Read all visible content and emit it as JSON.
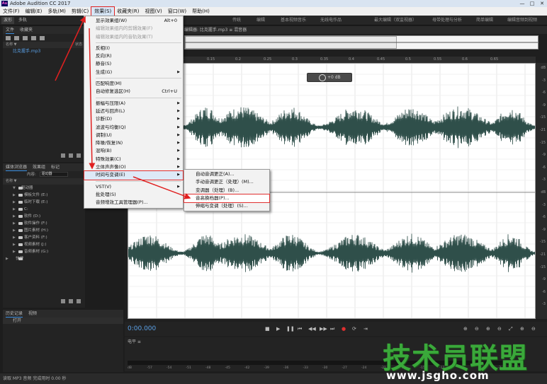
{
  "titlebar": {
    "title": "Adobe Audition CC 2017",
    "logo": "Au",
    "min": "—",
    "max": "□",
    "close": "✕"
  },
  "menubar": {
    "items": [
      "文件(F)",
      "编辑(E)",
      "多轨(M)",
      "剪辑(C)",
      "效果(S)",
      "收藏夹(R)",
      "视图(V)",
      "窗口(W)",
      "帮助(H)"
    ]
  },
  "toolbar": {
    "waveform": "波形",
    "multitrack": "多轨",
    "workspaces": [
      "传统",
      "编辑",
      "基本视频音乐",
      "无线电作品",
      "最大编辑（双监视器）",
      "母带处理与分析",
      "简单编辑",
      "编辑音频到视频"
    ]
  },
  "files_panel": {
    "tab_files": "文件",
    "tab_favorites": "收藏夹",
    "col_name": "名称 ▼",
    "col_status": "状态",
    "file": "比克握手.mp3"
  },
  "media_browser": {
    "tab_media": "媒体浏览器",
    "tab_effects": "效果组",
    "tab_markers": "标记",
    "content_label": "内容:",
    "content_value": "驱动器",
    "col_name": "名称 ▼",
    "drives_root": "驱动器",
    "drives": [
      "模板文件 (E:)",
      "临时下载 (E:)",
      "C:",
      "软件 (D:)",
      "软件操作 (F:)",
      "图片素材 (H:)",
      "客户资料 (F:)",
      "视频素材 (J:)",
      "音频素材 (G:)"
    ],
    "shortcut": "快捷"
  },
  "history_panel": {
    "tab_history": "历史记录",
    "tab_video": "视频",
    "item": "打开"
  },
  "editor": {
    "header": "编辑器: 比克握手.mp3 ≡   混音器",
    "timecode": "0:00.000",
    "hud_value": "+0 dB",
    "ruler_ticks": [
      "0.05",
      "0.1",
      "0.15",
      "0.2",
      "0.25",
      "0.3",
      "0.35",
      "0.4",
      "0.45",
      "0.5",
      "0.55",
      "0.6",
      "0.65"
    ],
    "db_labels": [
      "dB",
      "-3",
      "-6",
      "-9",
      "-15",
      "-21",
      "-15",
      "-9",
      "-6",
      "-3",
      "dB",
      "-3",
      "-6",
      "-9",
      "-15",
      "-21",
      "-15",
      "-9",
      "-6",
      "-3"
    ]
  },
  "levels": {
    "header": "电平 ≡",
    "ticks": [
      "dB",
      "-57",
      "-54",
      "-51",
      "-48",
      "-45",
      "-42",
      "-39",
      "-36",
      "-33",
      "-30",
      "-27",
      "-24",
      "-21",
      "-18",
      "-15",
      "-12",
      "-9",
      "-6",
      "-3",
      "0"
    ]
  },
  "statusbar": {
    "text": "读取 MP3 音频 完成用时 0.00 秒"
  },
  "effects_menu": {
    "items": [
      {
        "label": "显示效果组(W)",
        "shortcut": "Alt+0",
        "enabled": true
      },
      {
        "label": "编辑效果组内的剪辑效果(F)",
        "enabled": false
      },
      {
        "label": "编辑效果组内的音轨效果(T)",
        "enabled": false
      },
      {
        "sep": true
      },
      {
        "label": "反相(I)",
        "enabled": true
      },
      {
        "label": "反向(R)",
        "enabled": true
      },
      {
        "label": "静音(S)",
        "enabled": true
      },
      {
        "label": "生成(G)",
        "submenu": true,
        "enabled": true
      },
      {
        "sep": true
      },
      {
        "label": "匹配响度(M)",
        "enabled": true
      },
      {
        "label": "自动修复选区(H)",
        "shortcut": "Ctrl+U",
        "enabled": true
      },
      {
        "sep": true
      },
      {
        "label": "振幅与压限(A)",
        "submenu": true,
        "enabled": true
      },
      {
        "label": "延迟与回声(L)",
        "submenu": true,
        "enabled": true
      },
      {
        "label": "诊断(D)",
        "submenu": true,
        "enabled": true
      },
      {
        "label": "滤波与均衡(Q)",
        "submenu": true,
        "enabled": true
      },
      {
        "label": "调制(U)",
        "submenu": true,
        "enabled": true
      },
      {
        "label": "降噪/恢复(N)",
        "submenu": true,
        "enabled": true
      },
      {
        "label": "混响(B)",
        "submenu": true,
        "enabled": true
      },
      {
        "label": "特殊效果(C)",
        "submenu": true,
        "enabled": true
      },
      {
        "label": "立体声声像(O)",
        "submenu": true,
        "enabled": true
      },
      {
        "label": "时间与变调(E)",
        "submenu": true,
        "enabled": true,
        "highlight": true
      },
      {
        "sep": true
      },
      {
        "label": "VST(V)",
        "submenu": true,
        "enabled": true
      },
      {
        "label": "批处理(S)",
        "enabled": true
      },
      {
        "label": "音频增效工具管理器(P)...",
        "enabled": true
      }
    ]
  },
  "time_pitch_submenu": {
    "items": [
      {
        "label": "自动音调更正(A)..."
      },
      {
        "label": "手动音调更正（处理）(M)..."
      },
      {
        "label": "变调器（处理）(B)..."
      },
      {
        "label": "音高换档器(P)...",
        "highlight": true
      },
      {
        "label": "伸缩与变调（处理）(S)..."
      }
    ]
  },
  "transport": {
    "buttons": [
      "■",
      "▶",
      "❚❚",
      "⏮",
      "◀◀",
      "▶▶",
      "⏭",
      "●",
      "⟳",
      "⇥"
    ]
  },
  "watermark": {
    "logo": "技术员联盟",
    "url": "www.jsgho.com"
  },
  "colors": {
    "accent": "#5aa0e6",
    "waveform": "#2f4f4a",
    "highlight_border": "#e02020",
    "watermark_green": "#3aa83a"
  }
}
